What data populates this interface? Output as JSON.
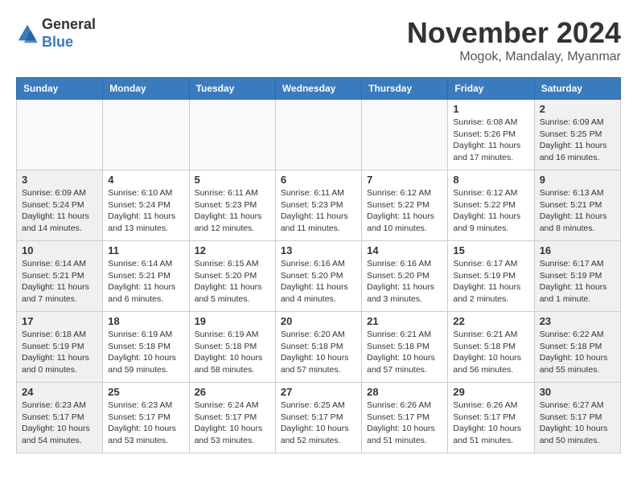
{
  "logo": {
    "general": "General",
    "blue": "Blue"
  },
  "title": "November 2024",
  "location": "Mogok, Mandalay, Myanmar",
  "days_of_week": [
    "Sunday",
    "Monday",
    "Tuesday",
    "Wednesday",
    "Thursday",
    "Friday",
    "Saturday"
  ],
  "weeks": [
    [
      {
        "day": "",
        "info": ""
      },
      {
        "day": "",
        "info": ""
      },
      {
        "day": "",
        "info": ""
      },
      {
        "day": "",
        "info": ""
      },
      {
        "day": "",
        "info": ""
      },
      {
        "day": "1",
        "info": "Sunrise: 6:08 AM\nSunset: 5:26 PM\nDaylight: 11 hours\nand 17 minutes."
      },
      {
        "day": "2",
        "info": "Sunrise: 6:09 AM\nSunset: 5:25 PM\nDaylight: 11 hours\nand 16 minutes."
      }
    ],
    [
      {
        "day": "3",
        "info": "Sunrise: 6:09 AM\nSunset: 5:24 PM\nDaylight: 11 hours\nand 14 minutes."
      },
      {
        "day": "4",
        "info": "Sunrise: 6:10 AM\nSunset: 5:24 PM\nDaylight: 11 hours\nand 13 minutes."
      },
      {
        "day": "5",
        "info": "Sunrise: 6:11 AM\nSunset: 5:23 PM\nDaylight: 11 hours\nand 12 minutes."
      },
      {
        "day": "6",
        "info": "Sunrise: 6:11 AM\nSunset: 5:23 PM\nDaylight: 11 hours\nand 11 minutes."
      },
      {
        "day": "7",
        "info": "Sunrise: 6:12 AM\nSunset: 5:22 PM\nDaylight: 11 hours\nand 10 minutes."
      },
      {
        "day": "8",
        "info": "Sunrise: 6:12 AM\nSunset: 5:22 PM\nDaylight: 11 hours\nand 9 minutes."
      },
      {
        "day": "9",
        "info": "Sunrise: 6:13 AM\nSunset: 5:21 PM\nDaylight: 11 hours\nand 8 minutes."
      }
    ],
    [
      {
        "day": "10",
        "info": "Sunrise: 6:14 AM\nSunset: 5:21 PM\nDaylight: 11 hours\nand 7 minutes."
      },
      {
        "day": "11",
        "info": "Sunrise: 6:14 AM\nSunset: 5:21 PM\nDaylight: 11 hours\nand 6 minutes."
      },
      {
        "day": "12",
        "info": "Sunrise: 6:15 AM\nSunset: 5:20 PM\nDaylight: 11 hours\nand 5 minutes."
      },
      {
        "day": "13",
        "info": "Sunrise: 6:16 AM\nSunset: 5:20 PM\nDaylight: 11 hours\nand 4 minutes."
      },
      {
        "day": "14",
        "info": "Sunrise: 6:16 AM\nSunset: 5:20 PM\nDaylight: 11 hours\nand 3 minutes."
      },
      {
        "day": "15",
        "info": "Sunrise: 6:17 AM\nSunset: 5:19 PM\nDaylight: 11 hours\nand 2 minutes."
      },
      {
        "day": "16",
        "info": "Sunrise: 6:17 AM\nSunset: 5:19 PM\nDaylight: 11 hours\nand 1 minute."
      }
    ],
    [
      {
        "day": "17",
        "info": "Sunrise: 6:18 AM\nSunset: 5:19 PM\nDaylight: 11 hours\nand 0 minutes."
      },
      {
        "day": "18",
        "info": "Sunrise: 6:19 AM\nSunset: 5:18 PM\nDaylight: 10 hours\nand 59 minutes."
      },
      {
        "day": "19",
        "info": "Sunrise: 6:19 AM\nSunset: 5:18 PM\nDaylight: 10 hours\nand 58 minutes."
      },
      {
        "day": "20",
        "info": "Sunrise: 6:20 AM\nSunset: 5:18 PM\nDaylight: 10 hours\nand 57 minutes."
      },
      {
        "day": "21",
        "info": "Sunrise: 6:21 AM\nSunset: 5:18 PM\nDaylight: 10 hours\nand 57 minutes."
      },
      {
        "day": "22",
        "info": "Sunrise: 6:21 AM\nSunset: 5:18 PM\nDaylight: 10 hours\nand 56 minutes."
      },
      {
        "day": "23",
        "info": "Sunrise: 6:22 AM\nSunset: 5:18 PM\nDaylight: 10 hours\nand 55 minutes."
      }
    ],
    [
      {
        "day": "24",
        "info": "Sunrise: 6:23 AM\nSunset: 5:17 PM\nDaylight: 10 hours\nand 54 minutes."
      },
      {
        "day": "25",
        "info": "Sunrise: 6:23 AM\nSunset: 5:17 PM\nDaylight: 10 hours\nand 53 minutes."
      },
      {
        "day": "26",
        "info": "Sunrise: 6:24 AM\nSunset: 5:17 PM\nDaylight: 10 hours\nand 53 minutes."
      },
      {
        "day": "27",
        "info": "Sunrise: 6:25 AM\nSunset: 5:17 PM\nDaylight: 10 hours\nand 52 minutes."
      },
      {
        "day": "28",
        "info": "Sunrise: 6:26 AM\nSunset: 5:17 PM\nDaylight: 10 hours\nand 51 minutes."
      },
      {
        "day": "29",
        "info": "Sunrise: 6:26 AM\nSunset: 5:17 PM\nDaylight: 10 hours\nand 51 minutes."
      },
      {
        "day": "30",
        "info": "Sunrise: 6:27 AM\nSunset: 5:17 PM\nDaylight: 10 hours\nand 50 minutes."
      }
    ]
  ]
}
